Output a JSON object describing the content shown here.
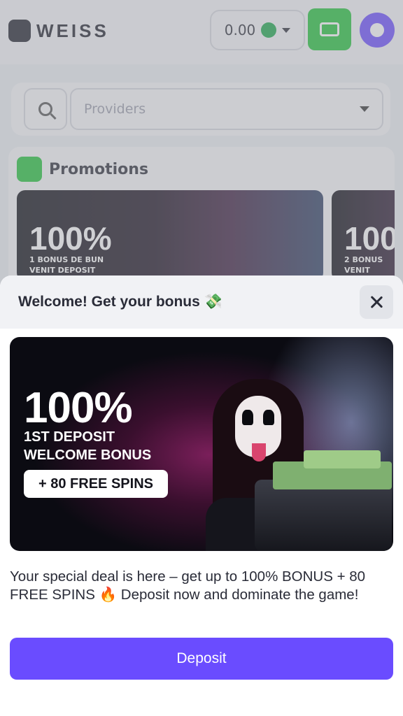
{
  "app": {
    "logo_text": "WEISS",
    "balance": "0.00",
    "providers_placeholder": "Providers",
    "promotions_title": "Promotions",
    "promo_card": {
      "percent": "100%",
      "line1": "1 BONUS DE BUN",
      "line2": "VENIT DEPOSIT"
    },
    "promo_card2": {
      "percent": "100",
      "line1": "2 BONUS",
      "line2": "VENIT"
    }
  },
  "modal": {
    "title": "Welcome! Get your bonus 💸",
    "banner": {
      "percent": "100%",
      "line1": "1ST DEPOSIT",
      "line2": "WELCOME BONUS",
      "pill": "+ 80 FREE SPINS"
    },
    "offer_text": "Your special deal is here – get up to 100% BONUS + 80 FREE SPINS 🔥 Deposit now and dominate the game!",
    "deposit_label": "Deposit"
  },
  "colors": {
    "accent": "#6a4cff",
    "wallet": "#22c33a",
    "coin": "#1aa64a"
  },
  "icons": {
    "logo": "weiss-logo-icon",
    "coin": "coin-icon",
    "wallet": "wallet-icon",
    "avatar": "user-icon",
    "search": "search-icon",
    "close": "close-icon"
  }
}
